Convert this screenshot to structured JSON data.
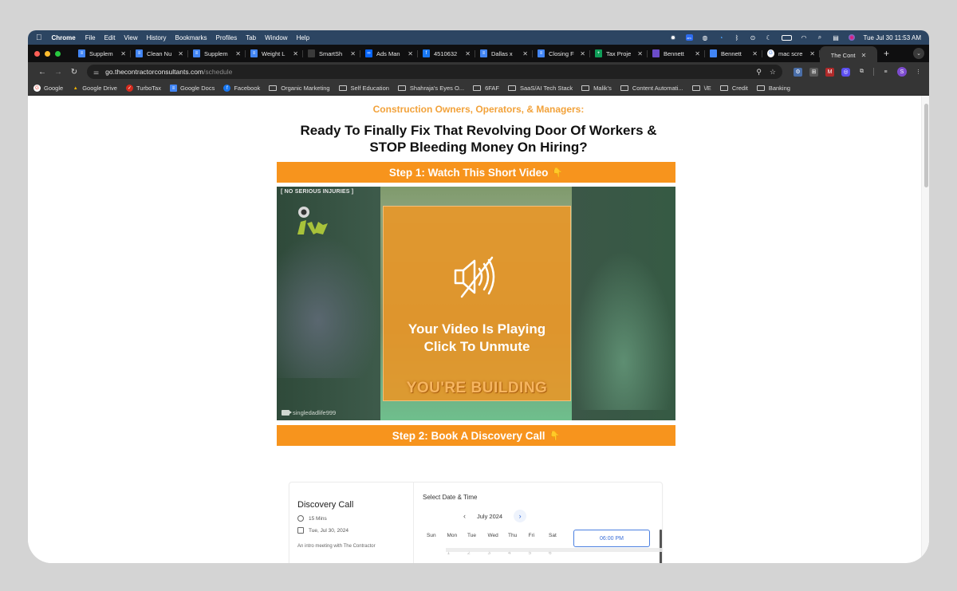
{
  "menubar": {
    "app_name": "Chrome",
    "items": [
      "File",
      "Edit",
      "View",
      "History",
      "Bookmarks",
      "Profiles",
      "Tab",
      "Window",
      "Help"
    ],
    "status_icons": [
      "gear-icon",
      "zoom-icon",
      "vpn-icon",
      "timer-icon",
      "bluetooth-icon",
      "play-icon",
      "moon-icon",
      "battery-icon",
      "wifi-icon",
      "search-icon",
      "control-center-icon",
      "siri-icon"
    ],
    "clock": "Tue Jul 30  11:53 AM"
  },
  "tabs": [
    {
      "title": "Supplem",
      "icon": "google-docs-icon",
      "color": "#4285f4"
    },
    {
      "title": "Clean Nu",
      "icon": "google-docs-icon",
      "color": "#4285f4"
    },
    {
      "title": "Supplem",
      "icon": "google-docs-icon",
      "color": "#4285f4"
    },
    {
      "title": "Weight L",
      "icon": "google-docs-icon",
      "color": "#4285f4"
    },
    {
      "title": "SmartSh",
      "icon": "page-icon",
      "color": "#3a3a3a"
    },
    {
      "title": "Ads Man",
      "icon": "meta-icon",
      "color": "#0866ff"
    },
    {
      "title": "4510632",
      "icon": "facebook-icon",
      "color": "#1877f2"
    },
    {
      "title": "Dallas x",
      "icon": "google-docs-icon",
      "color": "#4285f4"
    },
    {
      "title": "Closing F",
      "icon": "google-docs-icon",
      "color": "#4285f4"
    },
    {
      "title": "Tax Proje",
      "icon": "google-sheets-icon",
      "color": "#0f9d58"
    },
    {
      "title": "Bennett",
      "icon": "dots-icon",
      "color": "#6b4cc9"
    },
    {
      "title": "Bennett",
      "icon": "calendar-icon",
      "color": "#4285f4"
    },
    {
      "title": "mac scre",
      "icon": "google-icon",
      "color": "#ffffff"
    },
    {
      "title": "The Cont",
      "icon": "none",
      "color": "#353535",
      "active": true
    }
  ],
  "toolbar": {
    "url_host": "go.thecontractorconsultants.com",
    "url_path": "/schedule"
  },
  "bookmarks": [
    {
      "label": "Google",
      "icon": "google-icon"
    },
    {
      "label": "Google Drive",
      "icon": "google-drive-icon"
    },
    {
      "label": "TurboTax",
      "icon": "turbotax-icon"
    },
    {
      "label": "Google Docs",
      "icon": "google-docs-icon"
    },
    {
      "label": "Facebook",
      "icon": "facebook-icon"
    },
    {
      "label": "Organic Marketing",
      "icon": "folder-icon"
    },
    {
      "label": "Self Education",
      "icon": "folder-icon"
    },
    {
      "label": "Shahraja's Eyes O...",
      "icon": "folder-icon"
    },
    {
      "label": "6FAF",
      "icon": "folder-icon"
    },
    {
      "label": "SaaS/AI Tech Stack",
      "icon": "folder-icon"
    },
    {
      "label": "Malik's",
      "icon": "folder-icon"
    },
    {
      "label": "Content Automati...",
      "icon": "folder-icon"
    },
    {
      "label": "\\/E",
      "icon": "folder-icon"
    },
    {
      "label": "Credit",
      "icon": "folder-icon"
    },
    {
      "label": "Banking",
      "icon": "folder-icon"
    }
  ],
  "profile_initial": "S",
  "page": {
    "eyebrow": "Construction Owners, Operators, & Managers:",
    "headline_line1": "Ready To Finally Fix That Revolving Door Of Workers &",
    "headline_line2": "STOP Bleeding Money On Hiring?",
    "step1": "Step 1: Watch This Short Video",
    "step2": "Step 2: Book A Discovery Call",
    "step_emoji": "👇",
    "video": {
      "corner_label": "[ NO SERIOUS INJURIES ]",
      "overlay_line1": "Your Video Is Playing",
      "overlay_line2": "Click To Unmute",
      "caption": "YOU'RE BUILDING",
      "credit": "singledadlife999"
    },
    "accent": "#f7941d"
  },
  "booking": {
    "title": "Discovery Call",
    "duration": "15 Mins",
    "date": "Tue, Jul 30, 2024",
    "description": "An intro meeting with The Contractor",
    "select_label": "Select Date & Time",
    "month": "July 2024",
    "weekdays": [
      "Sun",
      "Mon",
      "Tue",
      "Wed",
      "Thu",
      "Fri",
      "Sat"
    ],
    "first_row_dates": [
      "",
      "1",
      "2",
      "3",
      "4",
      "5",
      "6"
    ],
    "time_slot": "06:00 PM"
  }
}
